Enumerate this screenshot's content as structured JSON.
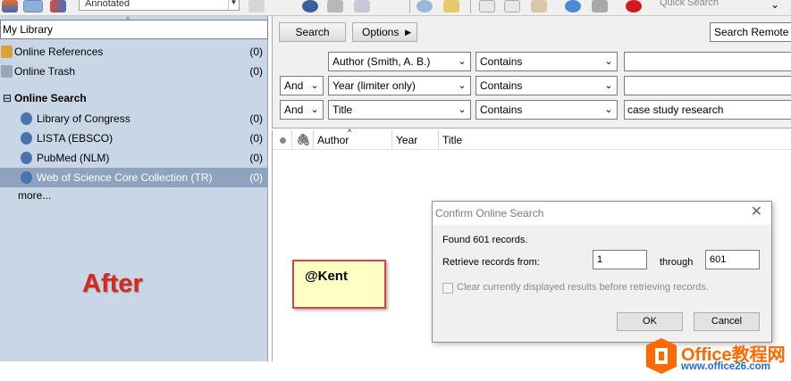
{
  "toolbar": {
    "style_combo": "Annotated",
    "quick_search": "Quick Search"
  },
  "library": {
    "title": "My Library",
    "groups": [
      {
        "label": "Online References",
        "count": "(0)"
      },
      {
        "label": "Online Trash",
        "count": "(0)"
      }
    ],
    "online_search": {
      "header": "Online Search",
      "sources": [
        {
          "label": "Library of Congress",
          "count": "(0)"
        },
        {
          "label": "LISTA (EBSCO)",
          "count": "(0)"
        },
        {
          "label": "PubMed (NLM)",
          "count": "(0)"
        },
        {
          "label": "Web of Science Core Collection (TR)",
          "count": "(0)"
        }
      ],
      "more": "more..."
    }
  },
  "overlay_text": "After",
  "note_text": "@Kent",
  "search_panel": {
    "search_button": "Search",
    "options_button": "Options",
    "remote_button": "Search Remote Library",
    "rows": [
      {
        "bool": "",
        "field": "Author (Smith, A. B.)",
        "op": "Contains",
        "value": ""
      },
      {
        "bool": "And",
        "field": "Year (limiter only)",
        "op": "Contains",
        "value": ""
      },
      {
        "bool": "And",
        "field": "Title",
        "op": "Contains",
        "value": "case study research"
      }
    ]
  },
  "results": {
    "columns": [
      "Author",
      "Year",
      "Title"
    ]
  },
  "dialog": {
    "title": "Confirm Online Search",
    "found": "Found 601 records.",
    "retrieve_label": "Retrieve records from:",
    "from": "1",
    "through_label": "through",
    "to": "601",
    "clear_label": "Clear currently displayed results before retrieving records.",
    "ok": "OK",
    "cancel": "Cancel"
  },
  "watermark": {
    "name": "Office教程网",
    "url": "www.office26.com"
  },
  "colors": {
    "left_pane": "#c8d6e6",
    "selected_row": "#8fa3bf",
    "after_text": "#d9271f",
    "note_bg": "#ffffc4",
    "note_border": "#d9434a",
    "watermark_orange": "#ff6a00"
  }
}
